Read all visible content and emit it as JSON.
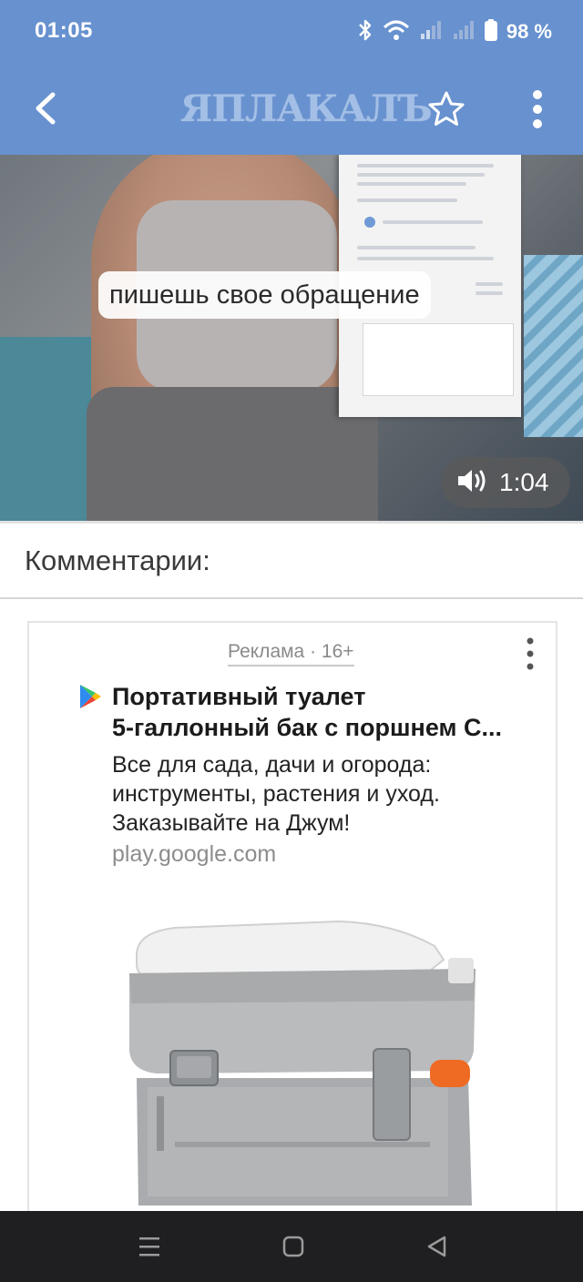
{
  "status_bar": {
    "time": "01:05",
    "battery_percent": "98 %",
    "icons": [
      "bluetooth-icon",
      "wifi-icon",
      "signal-icon",
      "signal-icon",
      "battery-icon"
    ]
  },
  "app_bar": {
    "logo_text": "ЯПЛАКАЛЪ",
    "back_icon": "back-arrow-icon",
    "favorite_icon": "star-outline-icon",
    "menu_icon": "kebab-menu-icon"
  },
  "video": {
    "caption": "пишешь свое обращение",
    "duration": "1:04",
    "volume_icon": "volume-icon"
  },
  "comments": {
    "title": "Комментарии:"
  },
  "ad": {
    "label": "Реклама · 16+",
    "title_line1": "Портативный туалет",
    "title_line2": "5-галлонный бак с поршнем C...",
    "description_line1": "Все для сада, дачи и огорода:",
    "description_line2": "инструменты, растения и уход.",
    "description_line3": "Заказывайте на Джум!",
    "domain": "play.google.com",
    "source_icon": "google-play-icon",
    "menu_icon": "kebab-menu-icon"
  },
  "nav_bar": {
    "recents_icon": "recents-icon",
    "home_icon": "home-icon",
    "back_icon": "back-triangle-icon"
  },
  "colors": {
    "brand_blue": "#6791cf",
    "nav_dark": "#1f1f21"
  }
}
